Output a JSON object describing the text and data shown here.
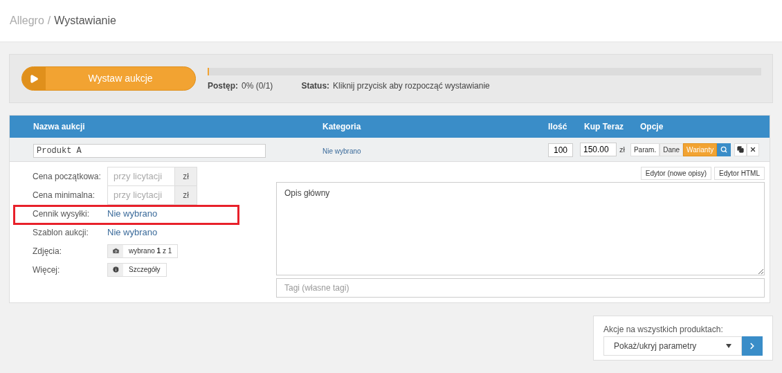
{
  "breadcrumb": {
    "items": [
      "Allegro",
      "Wystawianie"
    ],
    "separator": "/"
  },
  "launch": {
    "button": "Wystaw aukcje",
    "progress_label": "Postęp:",
    "progress_value": "0% (0/1)",
    "level": 0,
    "status_label": "Status:",
    "status_value": "Kliknij przycisk aby rozpocząć wystawianie"
  },
  "table": {
    "columns": [
      "Nazwa aukcji",
      "Kategoria",
      "Ilość",
      "Kup Teraz",
      "Opcje"
    ],
    "row": {
      "name": "Produkt A",
      "category": "Nie wybrano",
      "quantity": "100",
      "price": "150.00",
      "currency": "zł",
      "option_tabs": [
        {
          "label": "Param.",
          "selected": false
        },
        {
          "label": "Dane",
          "selected": false
        },
        {
          "label": "Warianty",
          "selected": true
        }
      ]
    }
  },
  "details": {
    "fields": [
      {
        "kind": "price",
        "label": "Cena początkowa:",
        "placeholder": "przy licytacji",
        "unit": "zł"
      },
      {
        "kind": "price",
        "label": "Cena minimalna:",
        "placeholder": "przy licytacji",
        "unit": "zł"
      },
      {
        "kind": "link",
        "label": "Cennik wysyłki:",
        "value": "Nie wybrano"
      },
      {
        "kind": "link",
        "label": "Szablon aukcji:",
        "value": "Nie wybrano"
      },
      {
        "kind": "photos",
        "label": "Zdjęcia:",
        "value": "wybrano **1** z 1"
      },
      {
        "kind": "more",
        "label": "Więcej:",
        "value": "Szczegóły"
      }
    ],
    "editor_buttons": [
      "Edytor (nowe opisy)",
      "Edytor HTML"
    ],
    "description": "Opis główny",
    "tags_placeholder": "Tagi (własne tagi)"
  },
  "bulk": {
    "label": "Akcje na wszystkich produktach:",
    "value": "Pokaż/ukryj parametry"
  }
}
